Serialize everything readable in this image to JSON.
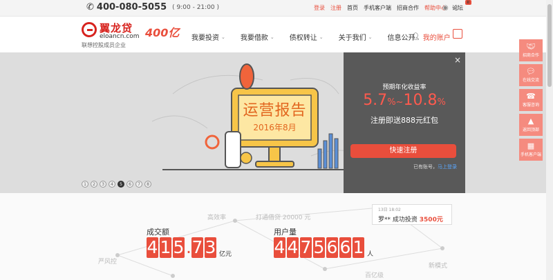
{
  "topbar": {
    "phone": "400-080-5055",
    "hours": "( 9:00 - 21:00 )",
    "links": {
      "login": "登录",
      "register": "注册",
      "home": "首页",
      "mobile": "手机客户端",
      "partner": "招商合作",
      "help": "帮助中心",
      "forum": "论坛",
      "forum_badge": "新"
    }
  },
  "nav": {
    "logo_brand": "翼龙贷",
    "logo_domain": "eloancn.com",
    "logo_sub": "联想控股成员企业",
    "logo_badge": "400亿",
    "items": [
      "我要投资",
      "我要借款",
      "债权转让",
      "关于我们",
      "信息公开"
    ],
    "account": "我的账户"
  },
  "banner": {
    "board_title": "运营报告",
    "board_sub": "2016年8月",
    "pager": [
      "1",
      "2",
      "3",
      "4",
      "5",
      "6",
      "7",
      "8"
    ],
    "active_index": 5
  },
  "panel": {
    "label": "预期年化收益率",
    "rate_low": "5.7",
    "rate_high": "10.8",
    "percent": "%",
    "tilde": "~",
    "gift": "注册即送888元红包",
    "register": "快速注册",
    "have_account": "已有账号，",
    "login_now": "马上登录",
    "close": "×"
  },
  "stats": {
    "volume_label": "成交额",
    "volume_digits": [
      "4",
      "1",
      "5",
      ".",
      "7",
      "3"
    ],
    "volume_unit": "亿元",
    "users_label": "用户量",
    "users_digits": [
      "4",
      "4",
      "7",
      "5",
      "6",
      "6",
      "1"
    ],
    "users_unit": "人",
    "ticker_time": "13日 18:02",
    "ticker_user": "罗**",
    "ticker_action": "成功投资",
    "ticker_amount": "3500元",
    "net_words": [
      "高效率",
      "严风控",
      "新模式",
      "百亿级",
      "打通借贷 20000 元"
    ]
  },
  "sidebar": [
    {
      "label": "招商合作",
      "icon": "handshake-icon"
    },
    {
      "label": "在线交流",
      "icon": "chat-icon"
    },
    {
      "label": "客服咨询",
      "icon": "service-icon"
    },
    {
      "label": "返回顶部",
      "icon": "arrow-up-icon"
    },
    {
      "label": "手机客户端",
      "icon": "qrcode-icon"
    }
  ],
  "colors": {
    "accent": "#e94e3c",
    "panel": "#595959",
    "banner": "#dddddd",
    "side": "#f58b7f"
  }
}
